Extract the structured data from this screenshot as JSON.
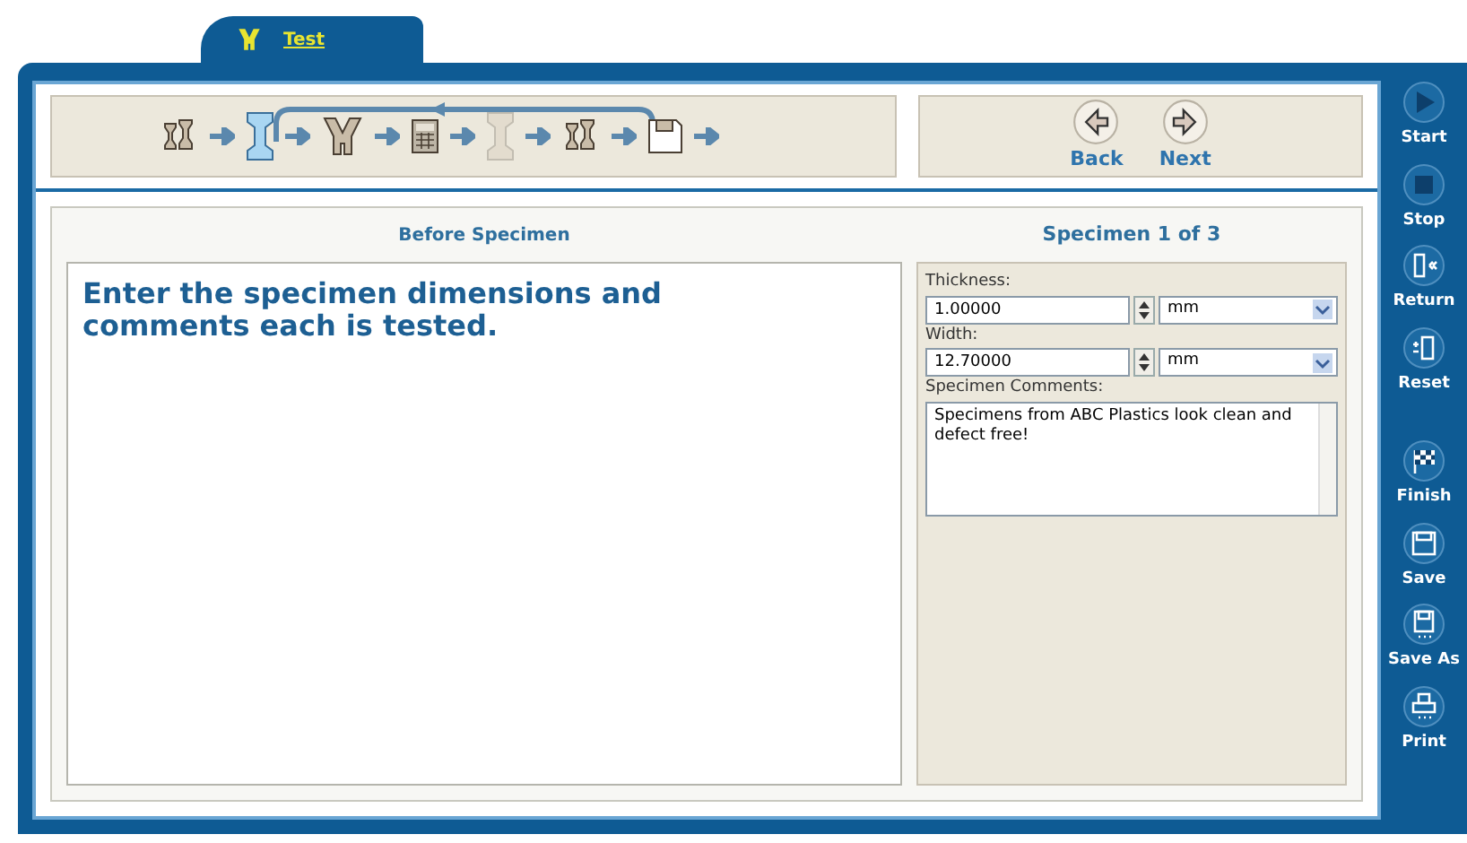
{
  "tab": {
    "label": "Test",
    "selected": true
  },
  "workflow": {
    "steps": [
      {
        "kind": "specimens",
        "selected": false,
        "disabled": false
      },
      {
        "kind": "specimen",
        "selected": true,
        "disabled": false
      },
      {
        "kind": "grips",
        "selected": false,
        "disabled": false
      },
      {
        "kind": "calculator",
        "selected": false,
        "disabled": false
      },
      {
        "kind": "specimen",
        "selected": false,
        "disabled": true
      },
      {
        "kind": "specimens",
        "selected": false,
        "disabled": false
      },
      {
        "kind": "disk",
        "selected": false,
        "disabled": false
      }
    ]
  },
  "nav": [
    {
      "kind": "back",
      "label": "Back"
    },
    {
      "kind": "next",
      "label": "Next"
    }
  ],
  "left_panel": {
    "heading": "Before Specimen",
    "instruction": "Enter the specimen dimensions and comments each is tested."
  },
  "right_panel": {
    "heading": "Specimen 1 of 3",
    "fields": [
      {
        "label": "Thickness:",
        "value": "1.00000",
        "unit": "mm"
      },
      {
        "label": "Width:",
        "value": "12.70000",
        "unit": "mm"
      }
    ],
    "comments": {
      "label": "Specimen Comments:",
      "value": "Specimens from ABC Plastics look clean and defect free!"
    }
  },
  "sidebar": {
    "top": [
      {
        "kind": "start",
        "label": "Start"
      },
      {
        "kind": "stop",
        "label": "Stop"
      },
      {
        "kind": "return",
        "label": "Return"
      },
      {
        "kind": "reset",
        "label": "Reset"
      }
    ],
    "bottom": [
      {
        "kind": "finish",
        "label": "Finish"
      },
      {
        "kind": "save",
        "label": "Save"
      },
      {
        "kind": "save_as",
        "label": "Save As"
      },
      {
        "kind": "print",
        "label": "Print"
      }
    ]
  }
}
